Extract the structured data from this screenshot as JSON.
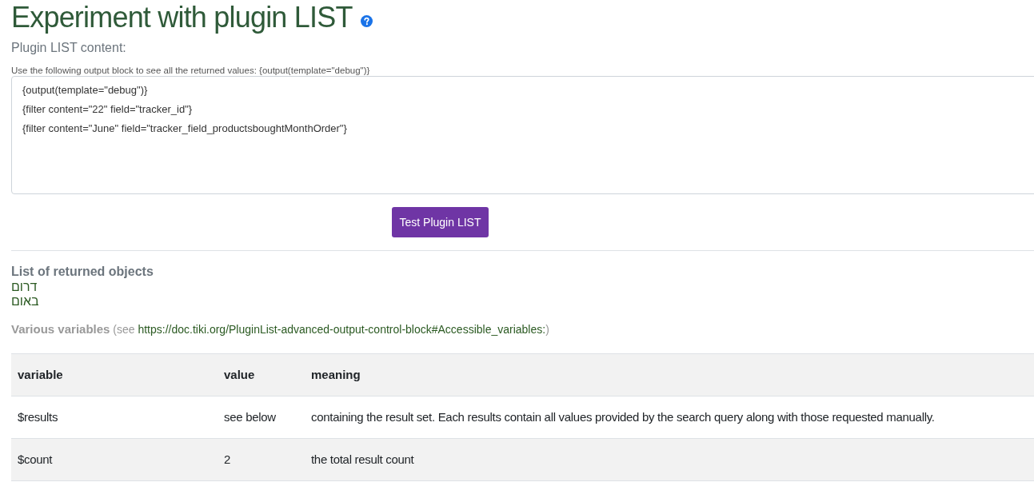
{
  "page": {
    "title": "Experiment with plugin LIST"
  },
  "content_label": "Plugin LIST content:",
  "hint": "Use the following output block to see all the returned values: {output(template=\"debug\")}",
  "editor": {
    "lines": [
      "{output(template=\"debug\")}",
      "{filter content=\"22\" field=\"tracker_id\"}",
      "{filter content=\"June\" field=\"tracker_field_productsboughtMonthOrder\"}"
    ]
  },
  "test_button": "Test Plugin LIST",
  "returned_objects": {
    "heading": "List of returned objects",
    "items": [
      "דרום",
      "באום"
    ]
  },
  "variables_note": {
    "label": "Various variables",
    "prefix": "(see ",
    "link": "https://doc.tiki.org/PluginList-advanced-output-control-block#Accessible_variables:",
    "suffix": ")"
  },
  "variables_table": {
    "columns": [
      "variable",
      "value",
      "meaning"
    ],
    "rows": [
      [
        "$results",
        "see below",
        "containing the result set. Each results contain all values provided by the search query along with those requested manually."
      ],
      [
        "$count",
        "2",
        "the total result count"
      ]
    ]
  }
}
